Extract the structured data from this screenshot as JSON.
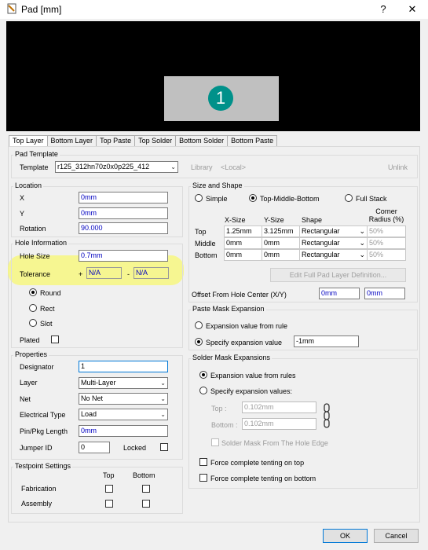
{
  "window": {
    "title": "Pad [mm]",
    "help_glyph": "?",
    "close_glyph": "✕"
  },
  "preview": {
    "pad_number": "1"
  },
  "tabs": [
    "Top Layer",
    "Bottom Layer",
    "Top Paste",
    "Top Solder",
    "Bottom Solder",
    "Bottom Paste"
  ],
  "pad_template": {
    "title": "Pad Template",
    "template_label": "Template",
    "template_value": "r125_312hn70z0x0p225_412",
    "library_label": "Library",
    "library_value": "<Local>",
    "unlink_label": "Unlink"
  },
  "location": {
    "title": "Location",
    "x_label": "X",
    "x_value": "0mm",
    "y_label": "Y",
    "y_value": "0mm",
    "rotation_label": "Rotation",
    "rotation_value": "90.000"
  },
  "hole": {
    "title": "Hole Information",
    "size_label": "Hole Size",
    "size_value": "0.7mm",
    "tolerance_label": "Tolerance",
    "tol_plus_sign": "+",
    "tol_plus": "N/A",
    "tol_minus_sign": "-",
    "tol_minus": "N/A",
    "shapes": [
      "Round",
      "Rect",
      "Slot"
    ],
    "selected_shape": "Round",
    "plated_label": "Plated"
  },
  "properties": {
    "title": "Properties",
    "designator_label": "Designator",
    "designator_value": "1",
    "layer_label": "Layer",
    "layer_value": "Multi-Layer",
    "net_label": "Net",
    "net_value": "No Net",
    "etype_label": "Electrical Type",
    "etype_value": "Load",
    "pinpkg_label": "Pin/Pkg Length",
    "pinpkg_value": "0mm",
    "jumper_label": "Jumper ID",
    "jumper_value": "0",
    "locked_label": "Locked"
  },
  "testpoint": {
    "title": "Testpoint Settings",
    "top_col": "Top",
    "bottom_col": "Bottom",
    "rows": [
      "Fabrication",
      "Assembly"
    ]
  },
  "size_shape": {
    "title": "Size and Shape",
    "modes": [
      "Simple",
      "Top-Middle-Bottom",
      "Full Stack"
    ],
    "selected_mode": "Top-Middle-Bottom",
    "col_x": "X-Size",
    "col_y": "Y-Size",
    "col_shape": "Shape",
    "col_radius": "Corner Radius (%)",
    "rows": [
      {
        "name": "Top",
        "x": "1.25mm",
        "y": "3.125mm",
        "shape": "Rectangular",
        "radius": "50%"
      },
      {
        "name": "Middle",
        "x": "0mm",
        "y": "0mm",
        "shape": "Rectangular",
        "radius": "50%"
      },
      {
        "name": "Bottom",
        "x": "0mm",
        "y": "0mm",
        "shape": "Rectangular",
        "radius": "50%"
      }
    ],
    "edit_full_button": "Edit Full Pad Layer Definition...",
    "offset_label": "Offset From Hole Center (X/Y)",
    "offset_x": "0mm",
    "offset_y": "0mm"
  },
  "paste_mask": {
    "title": "Paste Mask Expansion",
    "opt_rule": "Expansion value from rule",
    "opt_specify": "Specify expansion value",
    "specify_value": "-1mm",
    "selected": "specify"
  },
  "solder_mask": {
    "title": "Solder Mask Expansions",
    "opt_rules": "Expansion value from rules",
    "opt_specify": "Specify expansion values:",
    "selected": "rules",
    "top_label": "Top :",
    "top_value": "0.102mm",
    "bottom_label": "Bottom :",
    "bottom_value": "0.102mm",
    "from_hole_label": "Solder Mask From The Hole Edge",
    "tent_top": "Force complete tenting on top",
    "tent_bottom": "Force complete tenting on bottom"
  },
  "footer": {
    "ok": "OK",
    "cancel": "Cancel"
  },
  "colors": {
    "highlight": "#f7f779",
    "pad_fill": "#c0c0c0",
    "pad_number_bg": "#00918a"
  }
}
